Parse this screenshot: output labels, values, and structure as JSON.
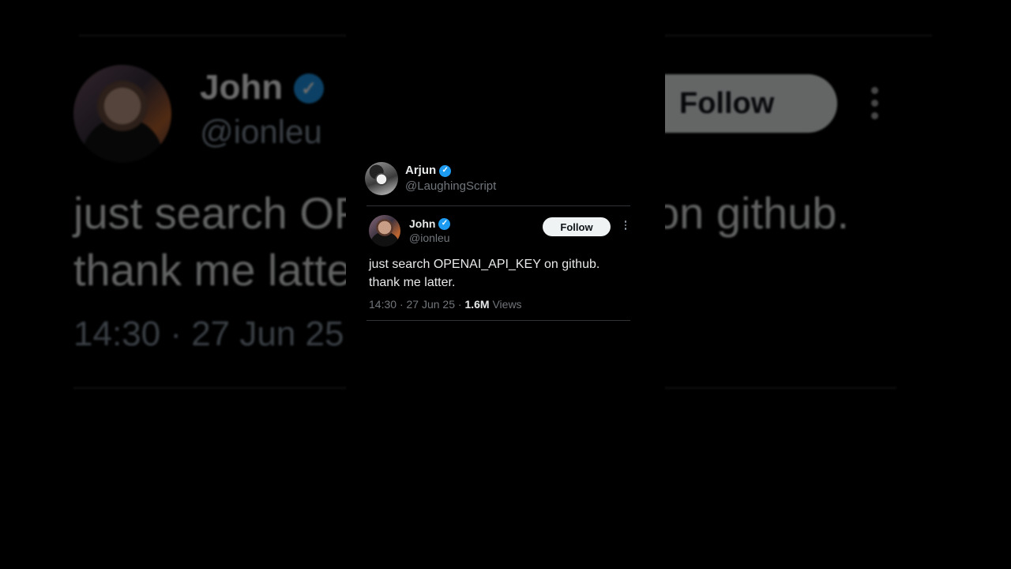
{
  "quoter": {
    "name": "Arjun",
    "handle": "@LaughingScript",
    "verified_icon": "verified-badge-icon"
  },
  "tweet": {
    "author_name": "John",
    "author_handle": "@ionleu",
    "follow_label": "Follow",
    "text_line1": "just search OPENAI_API_KEY on github.",
    "text_line2": "thank me latter.",
    "time": "14:30",
    "date": "27 Jun 25",
    "views_count": "1.6M",
    "views_label": "Views",
    "dot": "·"
  },
  "background_zoom": {
    "name": "John",
    "handle": "@ionleu",
    "follow_label": "Follow",
    "text_left_line1": "just search OP",
    "text_right_line1": "on github.",
    "text_left_line2": "thank me latte",
    "timestamp": "14:30 · 27 Jun 25"
  },
  "colors": {
    "background": "#000000",
    "verified": "#1d9bf0",
    "secondary_text": "#71767b",
    "primary_text": "#e7e9ea",
    "button_bg": "#eff3f4"
  }
}
